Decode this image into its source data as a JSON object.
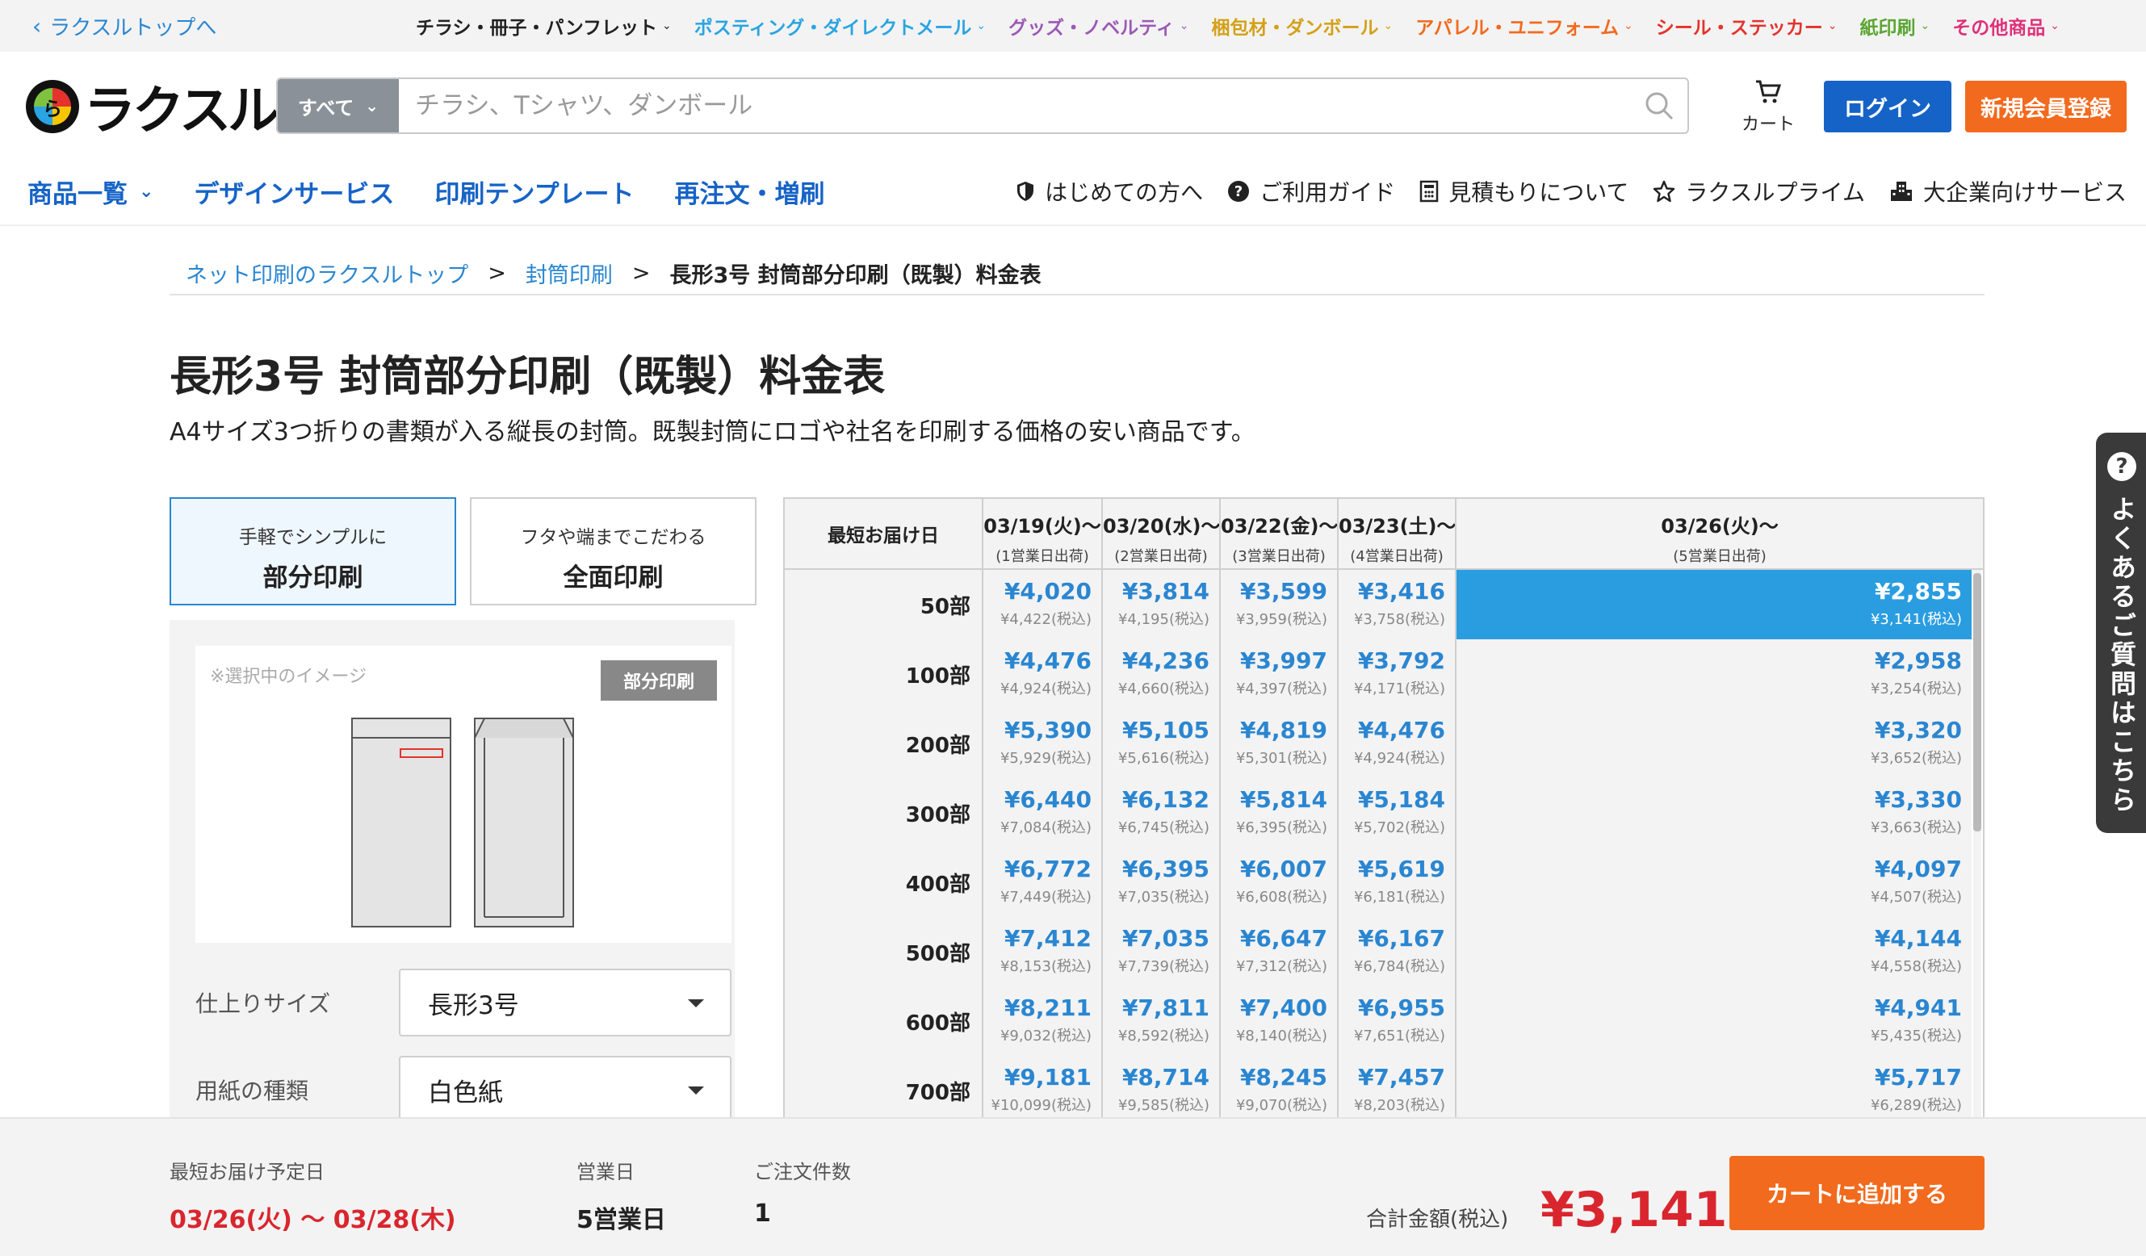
{
  "topbar": {
    "back_label": "ラクスルトップへ",
    "categories": [
      {
        "label": "チラシ・冊子・パンフレット",
        "color": "#222222"
      },
      {
        "label": "ポスティング・ダイレクトメール",
        "color": "#2aa4e2"
      },
      {
        "label": "グッズ・ノベルティ",
        "color": "#9b59b6"
      },
      {
        "label": "梱包材・ダンボール",
        "color": "#d4a017"
      },
      {
        "label": "アパレル・ユニフォーム",
        "color": "#f26a1d"
      },
      {
        "label": "シール・ステッカー",
        "color": "#e5322c"
      },
      {
        "label": "紙印刷",
        "color": "#5aa632"
      },
      {
        "label": "その他商品",
        "color": "#e0307a"
      }
    ]
  },
  "header": {
    "logo_text": "ラクスル",
    "search_scope": "すべて",
    "search_placeholder": "チラシ、Tシャツ、ダンボール",
    "cart_label": "カート",
    "login_label": "ログイン",
    "register_label": "新規会員登録"
  },
  "nav": {
    "main": [
      {
        "label": "商品一覧",
        "dropdown": true
      },
      {
        "label": "デザインサービス"
      },
      {
        "label": "印刷テンプレート"
      },
      {
        "label": "再注文・増刷"
      }
    ],
    "sub": [
      {
        "label": "はじめての方へ",
        "icon": "shield-icon"
      },
      {
        "label": "ご利用ガイド",
        "icon": "help-circle-icon"
      },
      {
        "label": "見積もりについて",
        "icon": "calculator-icon"
      },
      {
        "label": "ラクスルプライム",
        "icon": "star-icon"
      },
      {
        "label": "大企業向けサービス",
        "icon": "building-icon"
      }
    ]
  },
  "breadcrumb": {
    "items": [
      "ネット印刷のラクスルトップ",
      "封筒印刷"
    ],
    "current": "長形3号 封筒部分印刷（既製）料金表",
    "separator": ">"
  },
  "page": {
    "title": "長形3号 封筒部分印刷（既製）料金表",
    "description": "A4サイズ3つ折りの書類が入る縦長の封筒。既製封筒にロゴや社名を印刷する価格の安い商品です。"
  },
  "print_tabs": [
    {
      "sub": "手軽でシンプルに",
      "main": "部分印刷",
      "active": true
    },
    {
      "sub": "フタや端までこだわる",
      "main": "全面印刷",
      "active": false
    }
  ],
  "preview": {
    "caption": "※選択中のイメージ",
    "badge": "部分印刷"
  },
  "options": [
    {
      "label": "仕上りサイズ",
      "value": "長形3号"
    },
    {
      "label": "用紙の種類",
      "value": "白色紙"
    }
  ],
  "price_table": {
    "corner_label": "最短お届け日",
    "columns": [
      {
        "date": "03/19(火)〜",
        "note": "(1営業日出荷)"
      },
      {
        "date": "03/20(水)〜",
        "note": "(2営業日出荷)"
      },
      {
        "date": "03/22(金)〜",
        "note": "(3営業日出荷)"
      },
      {
        "date": "03/23(土)〜",
        "note": "(4営業日出荷)"
      },
      {
        "date": "03/26(火)〜",
        "note": "(5営業日出荷)"
      }
    ],
    "selected": {
      "row": 0,
      "col": 4
    },
    "rows": [
      {
        "qty": "50部",
        "prices": [
          [
            "¥4,020",
            "¥4,422(税込)"
          ],
          [
            "¥3,814",
            "¥4,195(税込)"
          ],
          [
            "¥3,599",
            "¥3,959(税込)"
          ],
          [
            "¥3,416",
            "¥3,758(税込)"
          ],
          [
            "¥2,855",
            "¥3,141(税込)"
          ]
        ]
      },
      {
        "qty": "100部",
        "prices": [
          [
            "¥4,476",
            "¥4,924(税込)"
          ],
          [
            "¥4,236",
            "¥4,660(税込)"
          ],
          [
            "¥3,997",
            "¥4,397(税込)"
          ],
          [
            "¥3,792",
            "¥4,171(税込)"
          ],
          [
            "¥2,958",
            "¥3,254(税込)"
          ]
        ]
      },
      {
        "qty": "200部",
        "prices": [
          [
            "¥5,390",
            "¥5,929(税込)"
          ],
          [
            "¥5,105",
            "¥5,616(税込)"
          ],
          [
            "¥4,819",
            "¥5,301(税込)"
          ],
          [
            "¥4,476",
            "¥4,924(税込)"
          ],
          [
            "¥3,320",
            "¥3,652(税込)"
          ]
        ]
      },
      {
        "qty": "300部",
        "prices": [
          [
            "¥6,440",
            "¥7,084(税込)"
          ],
          [
            "¥6,132",
            "¥6,745(税込)"
          ],
          [
            "¥5,814",
            "¥6,395(税込)"
          ],
          [
            "¥5,184",
            "¥5,702(税込)"
          ],
          [
            "¥3,330",
            "¥3,663(税込)"
          ]
        ]
      },
      {
        "qty": "400部",
        "prices": [
          [
            "¥6,772",
            "¥7,449(税込)"
          ],
          [
            "¥6,395",
            "¥7,035(税込)"
          ],
          [
            "¥6,007",
            "¥6,608(税込)"
          ],
          [
            "¥5,619",
            "¥6,181(税込)"
          ],
          [
            "¥4,097",
            "¥4,507(税込)"
          ]
        ]
      },
      {
        "qty": "500部",
        "prices": [
          [
            "¥7,412",
            "¥8,153(税込)"
          ],
          [
            "¥7,035",
            "¥7,739(税込)"
          ],
          [
            "¥6,647",
            "¥7,312(税込)"
          ],
          [
            "¥6,167",
            "¥6,784(税込)"
          ],
          [
            "¥4,144",
            "¥4,558(税込)"
          ]
        ]
      },
      {
        "qty": "600部",
        "prices": [
          [
            "¥8,211",
            "¥9,032(税込)"
          ],
          [
            "¥7,811",
            "¥8,592(税込)"
          ],
          [
            "¥7,400",
            "¥8,140(税込)"
          ],
          [
            "¥6,955",
            "¥7,651(税込)"
          ],
          [
            "¥4,941",
            "¥5,435(税込)"
          ]
        ]
      },
      {
        "qty": "700部",
        "prices": [
          [
            "¥9,181",
            "¥10,099(税込)"
          ],
          [
            "¥8,714",
            "¥9,585(税込)"
          ],
          [
            "¥8,245",
            "¥9,070(税込)"
          ],
          [
            "¥7,457",
            "¥8,203(税込)"
          ],
          [
            "¥5,717",
            "¥6,289(税込)"
          ]
        ]
      }
    ]
  },
  "faq_tab": "よくあるご質問はこちら",
  "summary": {
    "delivery_label": "最短お届け予定日",
    "delivery_value": "03/26(火) 〜 03/28(木)",
    "days_label": "営業日",
    "days_value": "5営業日",
    "count_label": "ご注文件数",
    "count_value": "1",
    "total_label": "合計金額(税込)",
    "total_value": "¥3,141",
    "add_to_cart": "カートに追加する"
  },
  "colors": {
    "primary_blue": "#1663c7",
    "link_blue": "#2a86d1",
    "selected_cell": "#2a9de0",
    "orange": "#f26a1d",
    "price_red": "#d9262e"
  }
}
